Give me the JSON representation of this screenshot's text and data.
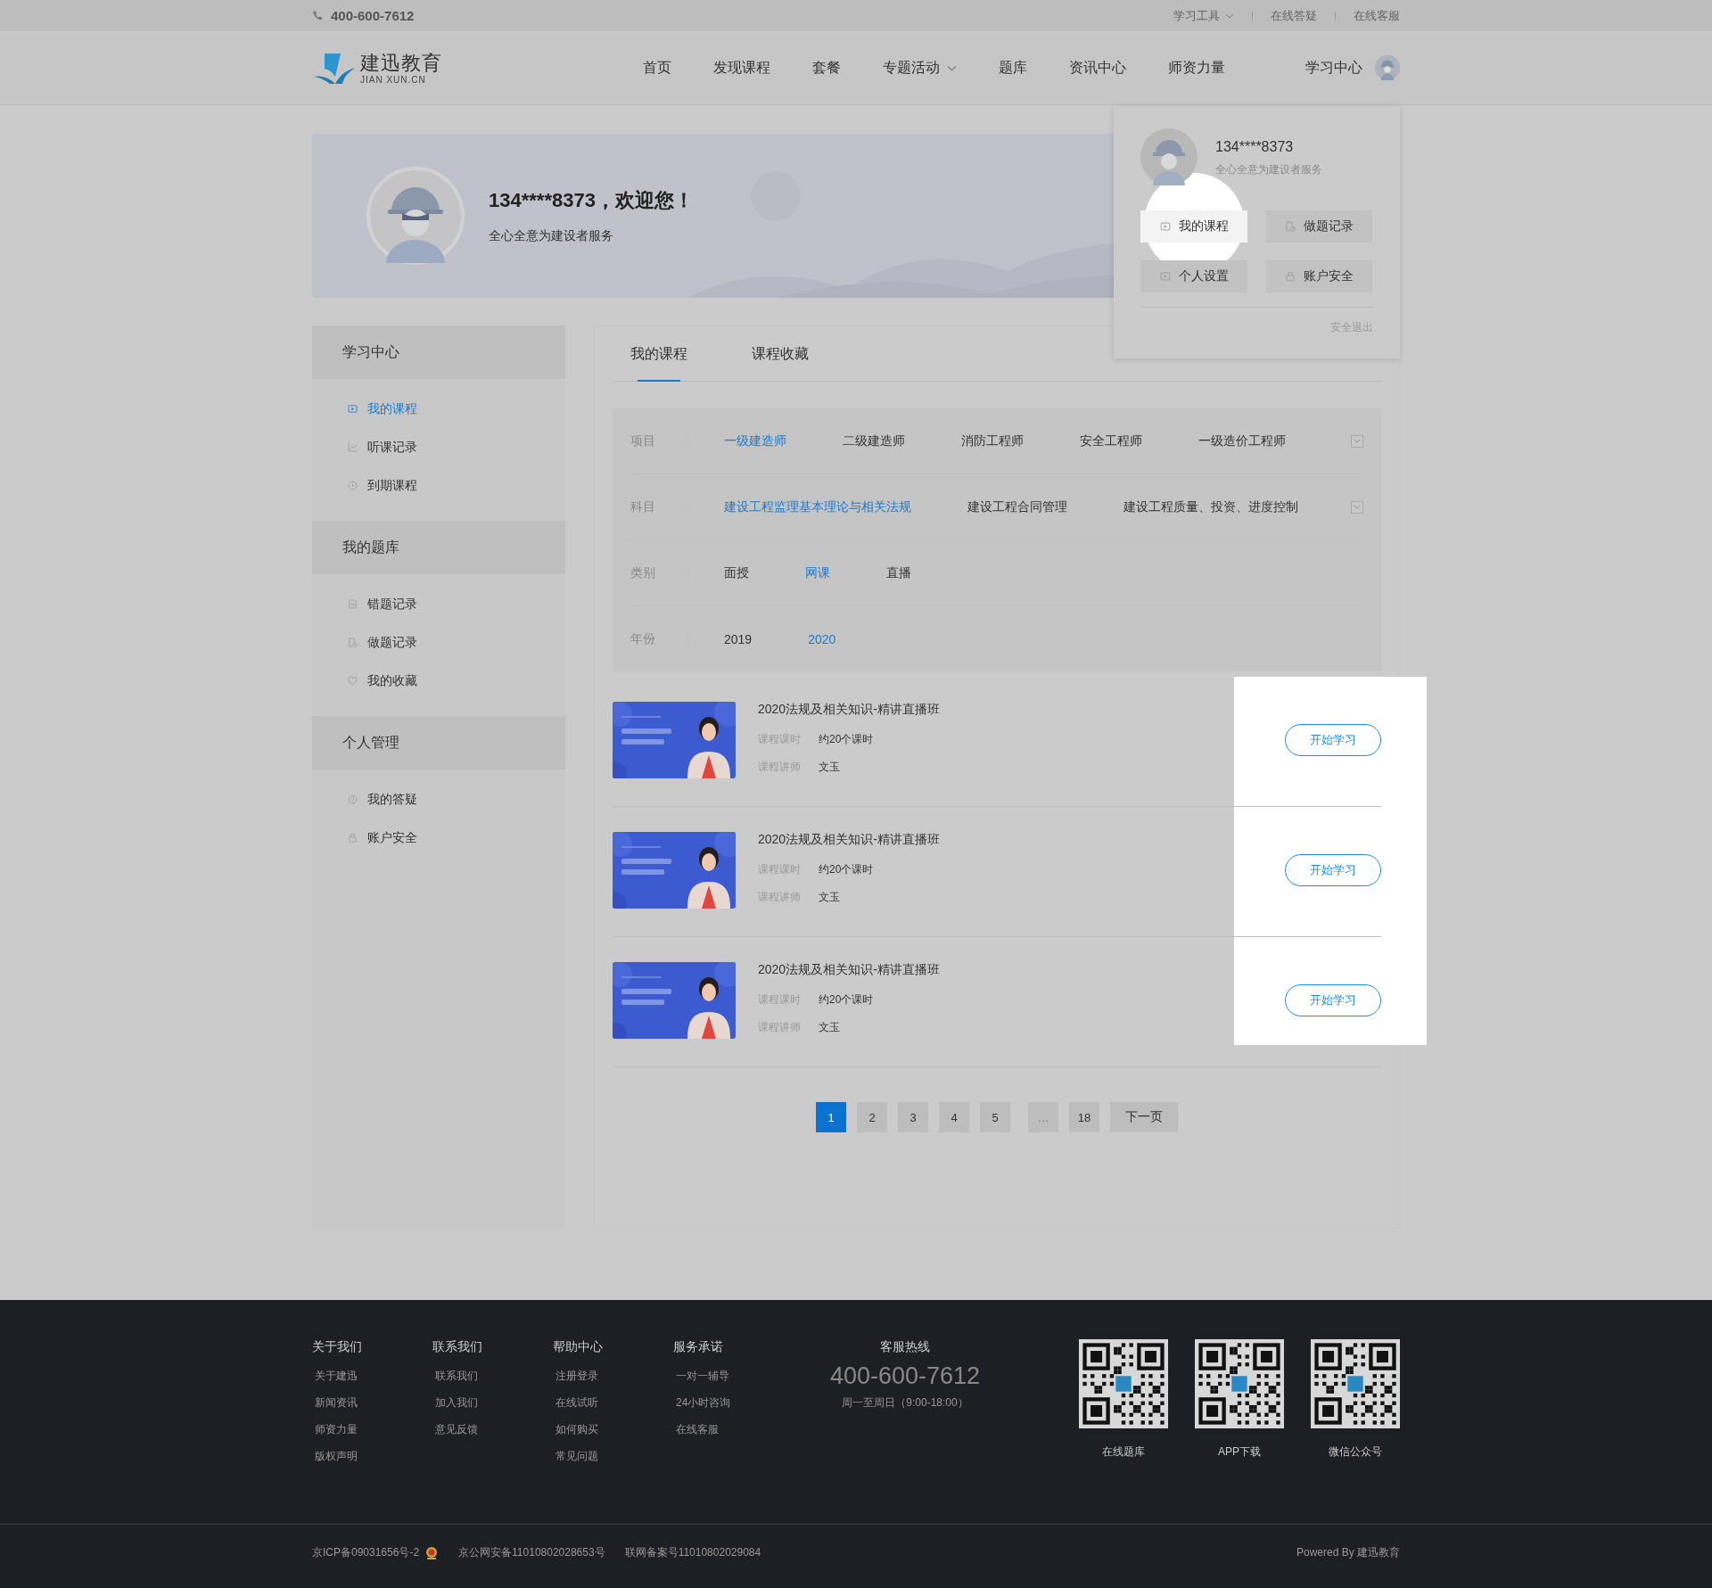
{
  "top_bar": {
    "phone": "400-600-7612",
    "links": [
      {
        "label": "学习工具",
        "dropdown": true
      },
      {
        "label": "在线答疑",
        "dropdown": false
      },
      {
        "label": "在线客服",
        "dropdown": false
      }
    ]
  },
  "header": {
    "logo": {
      "name": "建迅教育",
      "domain": "JIAN XUN.CN"
    },
    "nav": [
      {
        "label": "首页",
        "dropdown": false
      },
      {
        "label": "发现课程",
        "dropdown": false
      },
      {
        "label": "套餐",
        "dropdown": false
      },
      {
        "label": "专题活动",
        "dropdown": true
      },
      {
        "label": "题库",
        "dropdown": false
      },
      {
        "label": "资讯中心",
        "dropdown": false
      },
      {
        "label": "师资力量",
        "dropdown": false
      }
    ],
    "user_link": "学习中心"
  },
  "user_menu": {
    "phone": "134****8373",
    "slogan": "全心全意为建设者服务",
    "actions": [
      {
        "label": "我的课程",
        "kind": "play",
        "highlighted": true
      },
      {
        "label": "做题记录",
        "kind": "doc-clock",
        "highlighted": false
      },
      {
        "label": "个人设置",
        "kind": "play",
        "highlighted": false
      },
      {
        "label": "账户安全",
        "kind": "lock",
        "highlighted": false
      }
    ],
    "logout": "安全退出"
  },
  "banner": {
    "greeting": "134****8373，欢迎您！",
    "slogan": "全心全意为建设者服务"
  },
  "sidebar": [
    {
      "title": "学习中心",
      "items": [
        {
          "label": "我的课程",
          "kind": "play",
          "selected": true
        },
        {
          "label": "听课记录",
          "kind": "chart",
          "selected": false
        },
        {
          "label": "到期课程",
          "kind": "clock",
          "selected": false
        }
      ]
    },
    {
      "title": "我的题库",
      "items": [
        {
          "label": "错题记录",
          "kind": "doc-x",
          "selected": false
        },
        {
          "label": "做题记录",
          "kind": "doc-clock",
          "selected": false
        },
        {
          "label": "我的收藏",
          "kind": "heart",
          "selected": false
        }
      ]
    },
    {
      "title": "个人管理",
      "items": [
        {
          "label": "我的答疑",
          "kind": "question",
          "selected": false
        },
        {
          "label": "账户安全",
          "kind": "lock",
          "selected": false
        }
      ]
    }
  ],
  "tabs": [
    {
      "label": "我的课程",
      "selected": true
    },
    {
      "label": "课程收藏",
      "selected": false
    }
  ],
  "filters": [
    {
      "label": "项目",
      "expandable": true,
      "options": [
        {
          "label": "一级建造师",
          "selected": true
        },
        {
          "label": "二级建造师",
          "selected": false
        },
        {
          "label": "消防工程师",
          "selected": false
        },
        {
          "label": "安全工程师",
          "selected": false
        },
        {
          "label": "一级造价工程师",
          "selected": false
        }
      ]
    },
    {
      "label": "科目",
      "expandable": true,
      "options": [
        {
          "label": "建设工程监理基本理论与相关法规",
          "selected": true
        },
        {
          "label": "建设工程合同管理",
          "selected": false
        },
        {
          "label": "建设工程质量、投资、进度控制",
          "selected": false
        }
      ]
    },
    {
      "label": "类别",
      "expandable": false,
      "options": [
        {
          "label": "面授",
          "selected": false
        },
        {
          "label": "网课",
          "selected": true
        },
        {
          "label": "直播",
          "selected": false
        }
      ]
    },
    {
      "label": "年份",
      "expandable": false,
      "options": [
        {
          "label": "2019",
          "selected": false
        },
        {
          "label": "2020",
          "selected": true
        }
      ]
    }
  ],
  "course_list": {
    "highlighted": true,
    "items": [
      {
        "title": "2020法规及相关知识-精讲直播班",
        "hours_label": "课程课时",
        "hours": "约20个课时",
        "teacher_label": "课程讲师",
        "teacher": "文玉",
        "button": "开始学习"
      },
      {
        "title": "2020法规及相关知识-精讲直播班",
        "hours_label": "课程课时",
        "hours": "约20个课时",
        "teacher_label": "课程讲师",
        "teacher": "文玉",
        "button": "开始学习"
      },
      {
        "title": "2020法规及相关知识-精讲直播班",
        "hours_label": "课程课时",
        "hours": "约20个课时",
        "teacher_label": "课程讲师",
        "teacher": "文玉",
        "button": "开始学习"
      }
    ]
  },
  "pagination": {
    "pages": [
      {
        "label": "1",
        "kind": "page",
        "selected": true
      },
      {
        "label": "2",
        "kind": "page",
        "selected": false
      },
      {
        "label": "3",
        "kind": "page",
        "selected": false
      },
      {
        "label": "4",
        "kind": "page",
        "selected": false
      },
      {
        "label": "5",
        "kind": "page",
        "selected": false
      },
      {
        "label": "…",
        "kind": "ellipsis",
        "selected": false
      },
      {
        "label": "18",
        "kind": "page",
        "selected": false
      }
    ],
    "next": "下一页"
  },
  "footer": {
    "columns": [
      {
        "title": "关于我们",
        "links": [
          "关于建迅",
          "新闻资讯",
          "师资力量",
          "版权声明"
        ]
      },
      {
        "title": "联系我们",
        "links": [
          "联系我们",
          "加入我们",
          "意见反馈"
        ]
      },
      {
        "title": "帮助中心",
        "links": [
          "注册登录",
          "在线试听",
          "如何购买",
          "常见问题"
        ]
      },
      {
        "title": "服务承诺",
        "links": [
          "一对一辅导",
          "24小时咨询",
          "在线客服"
        ]
      }
    ],
    "hotline": {
      "title": "客服热线",
      "number": "400-600-7612",
      "hours": "周一至周日（9:00-18:00）"
    },
    "qr_codes": [
      {
        "label": "在线题库"
      },
      {
        "label": "APP下载"
      },
      {
        "label": "微信公众号"
      }
    ],
    "bottom": {
      "icp": "京ICP备09031656号-2",
      "police": "京公网安备11010802028653号",
      "network": "联网备案号11010802029084",
      "powered": "Powered By 建迅教育"
    }
  }
}
